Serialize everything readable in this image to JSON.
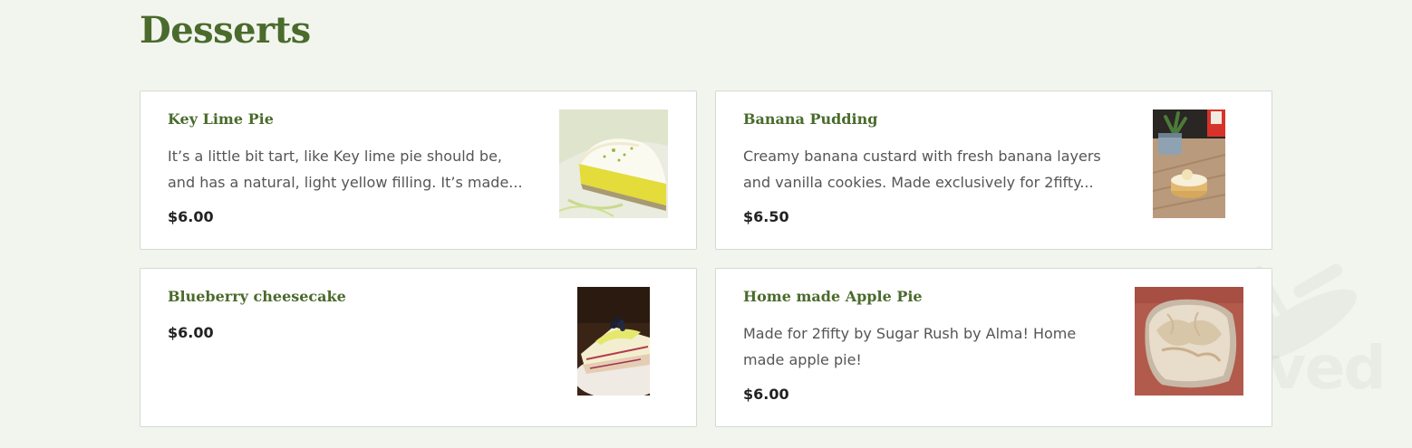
{
  "section": {
    "title": "Desserts"
  },
  "items": [
    {
      "name": "Key Lime Pie",
      "description": "It’s a little bit tart, like Key lime pie should be,\nand has a natural, light yellow filling. It’s made...",
      "price": "$6.00",
      "image_icon": "key-lime-pie-photo"
    },
    {
      "name": "Banana Pudding",
      "description": "Creamy banana custard with fresh banana layers\nand vanilla cookies. Made exclusively for 2fifty...",
      "price": "$6.50",
      "image_icon": "banana-pudding-photo"
    },
    {
      "name": "Blueberry cheesecake",
      "description": "",
      "price": "$6.00",
      "image_icon": "blueberry-cheesecake-photo"
    },
    {
      "name": "Home made Apple Pie",
      "description": "Made for 2fifty by Sugar Rush by Alma! Home\nmade apple pie!",
      "price": "$6.00",
      "image_icon": "apple-pie-photo"
    }
  ],
  "watermark": {
    "text": "rved"
  },
  "colors": {
    "background": "#f2f5ee",
    "accent": "#4a6b2c",
    "card_border": "#d5d9d1",
    "price": "#222222",
    "description": "#555555"
  }
}
